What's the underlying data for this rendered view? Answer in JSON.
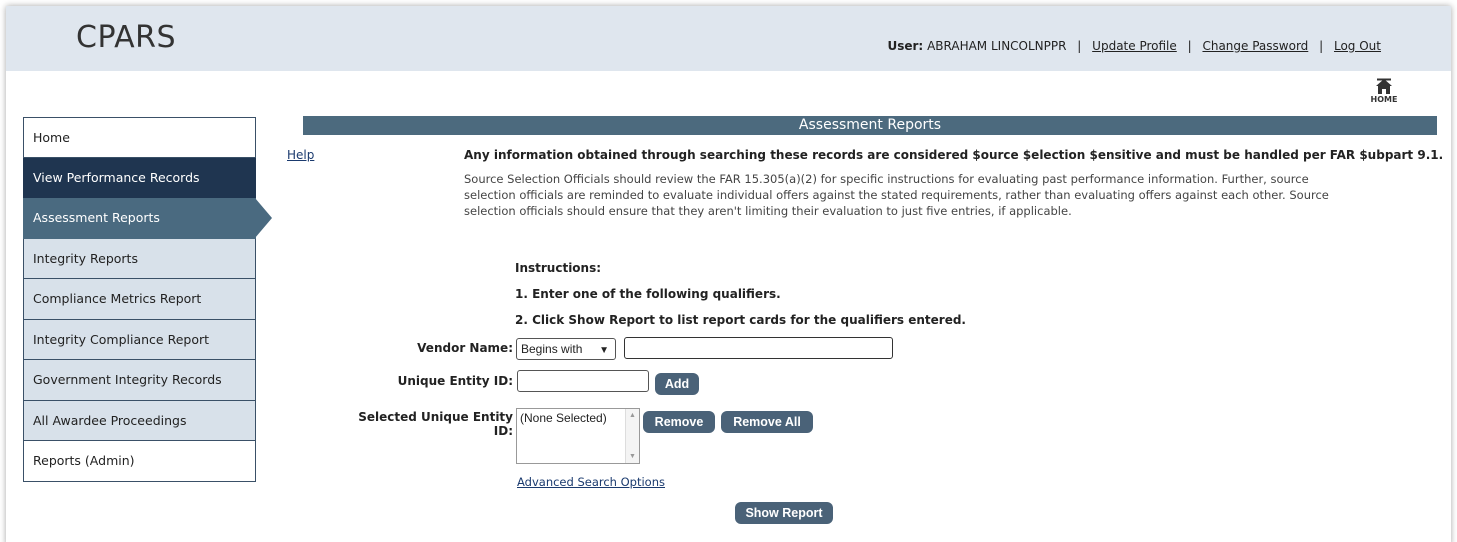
{
  "header": {
    "logo": "CPARS",
    "user_label": "User:",
    "user_name": "ABRAHAM LINCOLNPPR",
    "links": [
      "Update Profile",
      "Change Password",
      "Log Out"
    ],
    "separator": "|"
  },
  "home": {
    "label": "HOME",
    "icon": "home-icon"
  },
  "sidebar": {
    "items": [
      {
        "label": "Home"
      },
      {
        "label": "View Performance Records"
      },
      {
        "label": "Assessment Reports"
      },
      {
        "label": "Integrity Reports"
      },
      {
        "label": "Compliance Metrics Report"
      },
      {
        "label": "Integrity Compliance Report"
      },
      {
        "label": "Government Integrity Records"
      },
      {
        "label": "All Awardee Proceedings"
      },
      {
        "label": "Reports (Admin)"
      }
    ]
  },
  "main": {
    "section_title": "Assessment Reports",
    "help": "Help",
    "warning": "Any information obtained through searching these records are considered $ource $election $ensitive and must be handled per FAR $ubpart 9.1.",
    "intro": "Source Selection Officials should review the FAR 15.305(a)(2) for specific instructions for evaluating past performance information. Further, source selection officials are reminded to evaluate individual offers against the stated requirements, rather than evaluating offers against each other. Source selection officials should ensure that they aren't limiting their evaluation to just five entries, if applicable.",
    "instructions_title": "Instructions:",
    "instruction_1": "1. Enter one of the following qualifiers.",
    "instruction_2": "2. Click Show Report to list report cards for the qualifiers entered.",
    "vendor_label": "Vendor Name:",
    "vendor_match": "Begins with",
    "vendor_value": "",
    "uei_label": "Unique Entity ID:",
    "uei_value": "",
    "add_label": "Add",
    "selected_label": "Selected Unique Entity ID:",
    "selected_placeholder": "(None Selected)",
    "remove_label": "Remove",
    "remove_all_label": "Remove All",
    "advanced_link": "Advanced Search Options",
    "show_report_label": "Show Report"
  },
  "colors": {
    "header_bg": "#dfe6ee",
    "nav_dark": "#1f3550",
    "nav_active": "#4a6a80",
    "nav_light": "#d8e1ea",
    "section_bar": "#4c6a7e",
    "button": "#4a6278"
  }
}
